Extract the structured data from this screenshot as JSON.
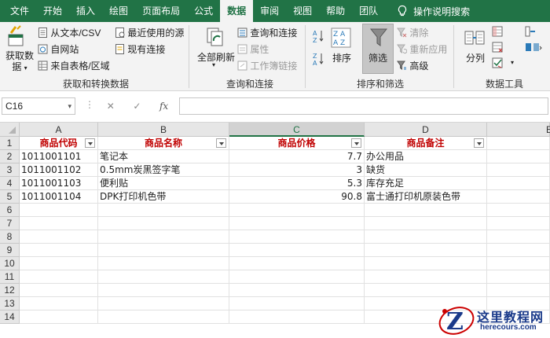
{
  "tabs": [
    "文件",
    "开始",
    "插入",
    "绘图",
    "页面布局",
    "公式",
    "数据",
    "审阅",
    "视图",
    "帮助",
    "团队"
  ],
  "active_tab": "数据",
  "search_label": "操作说明搜索",
  "ribbon": {
    "get_data": {
      "label_line1": "获取数",
      "label_line2": "据"
    },
    "from_text_csv": "从文本/CSV",
    "from_web": "自网站",
    "from_table": "来自表格/区域",
    "recent_sources": "最近使用的源",
    "existing_connections": "现有连接",
    "group_get_transform": "获取和转换数据",
    "refresh_all": "全部刷新",
    "queries_connections": "查询和连接",
    "properties": "属性",
    "edit_links": "工作簿链接",
    "group_queries": "查询和连接",
    "sort": "排序",
    "filter": "筛选",
    "clear": "清除",
    "reapply": "重新应用",
    "advanced": "高级",
    "group_sort_filter": "排序和筛选",
    "split": "分列",
    "group_data_tools": "数据工具"
  },
  "formula_bar": {
    "name_box": "C16",
    "formula": ""
  },
  "columns": [
    "A",
    "B",
    "C",
    "D",
    "E"
  ],
  "rows": [
    "1",
    "2",
    "3",
    "4",
    "5",
    "6",
    "7",
    "8",
    "9",
    "10",
    "11",
    "12",
    "13",
    "14"
  ],
  "table": {
    "headers": [
      "商品代码",
      "商品名称",
      "商品价格",
      "商品备注"
    ],
    "data": [
      [
        "1011001101",
        "笔记本",
        "7.7",
        "办公用品"
      ],
      [
        "1011001102",
        "0.5mm炭黑签字笔",
        "3",
        "缺货"
      ],
      [
        "1011001103",
        "便利贴",
        "5.3",
        "库存充足"
      ],
      [
        "1011001104",
        "DPK打印机色带",
        "90.8",
        "富士通打印机原装色带"
      ]
    ]
  },
  "watermark": {
    "brand": "这里教程网",
    "url": "herecours.com"
  },
  "colors": {
    "excel_green": "#217346",
    "header_text": "#c00000"
  }
}
